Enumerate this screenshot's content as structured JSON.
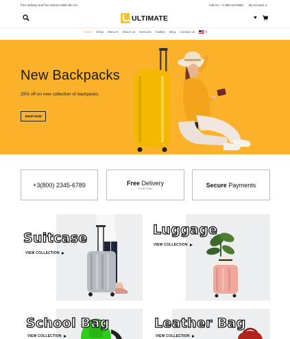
{
  "topbar": {
    "free_delivery": "Free delivery and free returns within the US.",
    "call": "Call Us : +1 555 123 8069",
    "account": "My Account"
  },
  "header": {
    "logo": "ULTIMATE",
    "brand_color": "#f8c22a"
  },
  "nav": {
    "items": [
      "Home",
      "Shop",
      "Menu",
      "About Us",
      "Services",
      "Gallery",
      "Blog",
      "Contact us"
    ],
    "active_color": "#e4b400"
  },
  "hero": {
    "title": "New Backpacks",
    "subtitle": "25% off on new collection of backpacks",
    "button": "SHOP NOW",
    "background": "#fbb12a"
  },
  "info": {
    "phone": "+3(800) 2345-6789",
    "delivery_bold": "Free",
    "delivery_rest": " Delivery",
    "delivery_small": "On All Order",
    "payments_bold": "Secure",
    "payments_rest": " Payments"
  },
  "categories": [
    {
      "title": "Suitcase",
      "cta": "VIEW COLLECTION"
    },
    {
      "title": "Luggage",
      "cta": "VIEW COLLECTION"
    },
    {
      "title": "School Bag",
      "cta": "VIEW COLLECTION"
    },
    {
      "title": "Leather Bag",
      "cta": "VIEW COLLECTION"
    }
  ]
}
